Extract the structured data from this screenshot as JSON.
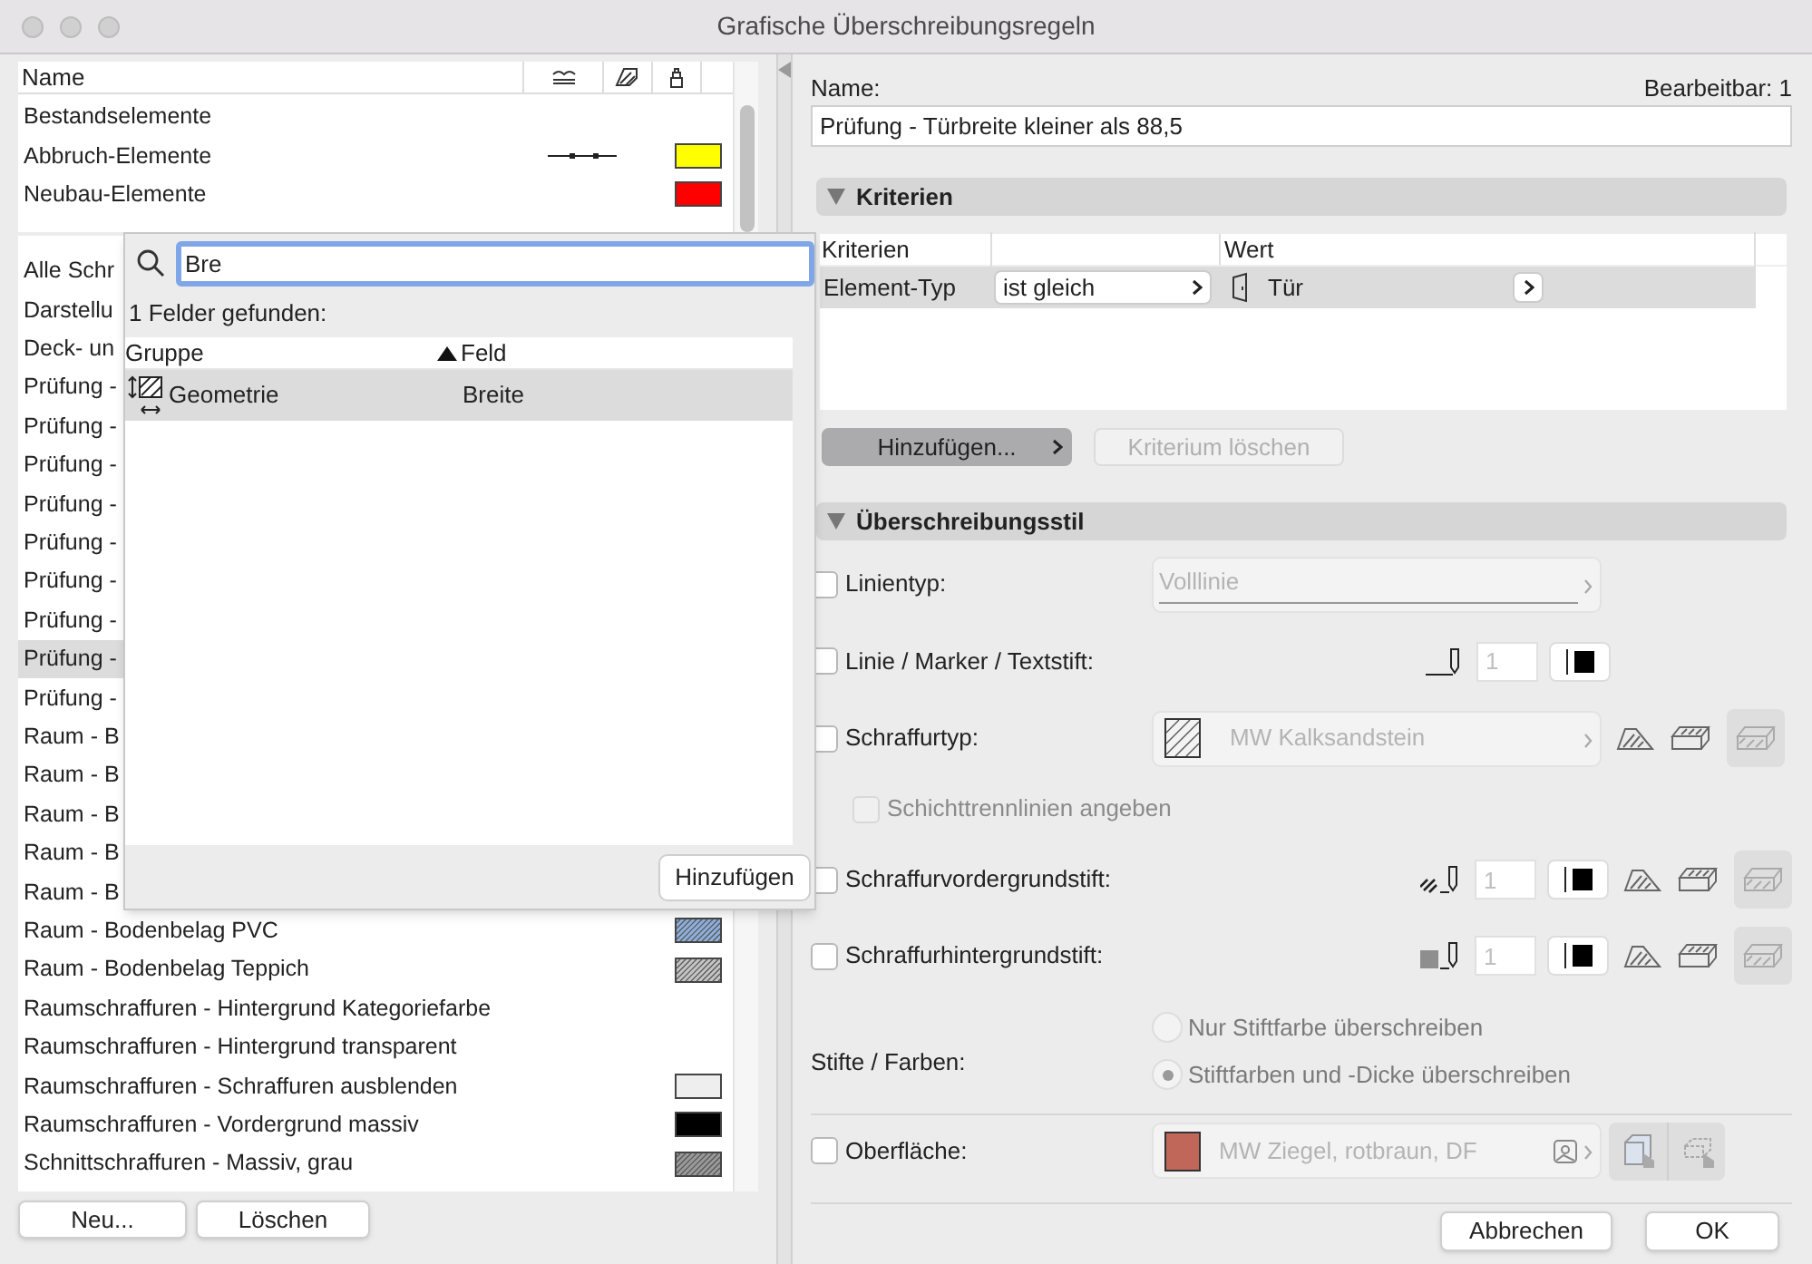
{
  "window": {
    "title": "Grafische Überschreibungsregeln"
  },
  "rule_list": {
    "column": "Name",
    "top_rows": [
      {
        "name": "Bestandselemente",
        "selected": false,
        "line_style": false
      },
      {
        "name": "Abbruch-Elemente",
        "selected": false,
        "line_style": true,
        "swatch": {
          "color": "#ffff00",
          "hatched": false
        }
      },
      {
        "name": "Neubau-Elemente",
        "selected": false,
        "line_style": false,
        "swatch": {
          "color": "#ff0000",
          "hatched": false
        }
      }
    ],
    "rows": [
      {
        "name": "Alle Schr",
        "selected": false
      },
      {
        "name": "Darstellu",
        "selected": false
      },
      {
        "name": "Deck- un",
        "selected": false
      },
      {
        "name": "Prüfung -",
        "selected": false
      },
      {
        "name": "Prüfung -",
        "selected": false
      },
      {
        "name": "Prüfung -",
        "selected": false
      },
      {
        "name": "Prüfung -",
        "selected": false
      },
      {
        "name": "Prüfung -",
        "selected": false
      },
      {
        "name": "Prüfung -",
        "selected": false
      },
      {
        "name": "Prüfung -",
        "selected": false
      },
      {
        "name": "Prüfung -",
        "selected": true
      },
      {
        "name": "Prüfung -",
        "selected": false
      },
      {
        "name": "Raum - B",
        "selected": false
      },
      {
        "name": "Raum - B",
        "selected": false
      },
      {
        "name": "Raum - B",
        "selected": false
      },
      {
        "name": "Raum - B",
        "selected": false
      },
      {
        "name": "Raum - B",
        "selected": false
      },
      {
        "name": "Raum - Bodenbelag PVC",
        "selected": false,
        "swatch": {
          "color": "#8fb0dc",
          "hatched": true
        }
      },
      {
        "name": "Raum - Bodenbelag Teppich",
        "selected": false,
        "swatch": {
          "color": "#c4c4c4",
          "hatched": true
        }
      },
      {
        "name": "Raumschraffuren - Hintergrund Kategoriefarbe",
        "selected": false
      },
      {
        "name": "Raumschraffuren - Hintergrund transparent",
        "selected": false
      },
      {
        "name": "Raumschraffuren - Schraffuren ausblenden",
        "selected": false,
        "swatch": {
          "color": "#eeeeee",
          "hatched": false
        }
      },
      {
        "name": "Raumschraffuren - Vordergrund massiv",
        "selected": false,
        "swatch": {
          "color": "#000000",
          "hatched": false
        }
      },
      {
        "name": "Schnittschraffuren - Massiv, grau",
        "selected": false,
        "swatch": {
          "color": "#9a9a9a",
          "hatched": true
        }
      }
    ],
    "buttons": [
      "Neu...",
      "Löschen"
    ]
  },
  "search_popup": {
    "query": "Bre",
    "result_count": "1 Felder gefunden:",
    "columns": [
      {
        "label": "Gruppe",
        "sorted": false
      },
      {
        "label": "Feld",
        "sorted": true
      }
    ],
    "results": [
      {
        "group": "Geometrie",
        "field": "Breite",
        "selected": true
      }
    ],
    "add_button": "Hinzufügen"
  },
  "editor": {
    "name_label": "Name:",
    "editable": "Bearbeitbar: 1",
    "name_value": "Prüfung - Türbreite kleiner als 88,5",
    "criteria_section": {
      "title": "Kriterien",
      "expanded": true,
      "columns": {
        "criterion": "Kriterien",
        "value": "Wert"
      },
      "rows": [
        {
          "criterion": "Element-Typ",
          "operator": "ist gleich",
          "value": "Tür",
          "selected": true
        }
      ],
      "buttons": [
        {
          "label": "Hinzufügen...",
          "disabled": false
        },
        {
          "label": "Kriterium löschen",
          "disabled": true
        }
      ]
    },
    "style_section": {
      "title": "Überschreibungsstil",
      "expanded": true,
      "options": [
        {
          "kind": "linetype",
          "label": "Linientyp:",
          "checked": false,
          "value": "Volllinie"
        },
        {
          "kind": "pen",
          "label": "Linie / Marker / Textstift:",
          "checked": false,
          "pen": "1"
        },
        {
          "kind": "hatch",
          "label": "Schraffurtyp:",
          "checked": false,
          "value": "MW Kalksandstein"
        },
        {
          "kind": "subcheck",
          "label": "Schichttrennlinien angeben",
          "checked": false,
          "disabled": true
        },
        {
          "kind": "hatchpen",
          "label": "Schraffurvordergrundstift:",
          "checked": false,
          "pen": "1"
        },
        {
          "kind": "hatchpen",
          "label": "Schraffurhintergrundstift:",
          "checked": false,
          "pen": "1"
        },
        {
          "kind": "radio",
          "label": "Stifte / Farben:",
          "choices": [
            {
              "label": "Nur Stiftfarbe überschreiben",
              "selected": false
            },
            {
              "label": "Stiftfarben und -Dicke überschreiben",
              "selected": true
            }
          ]
        },
        {
          "kind": "surface",
          "label": "Oberfläche:",
          "checked": false,
          "value": "MW Ziegel, rotbraun, DF"
        }
      ]
    }
  },
  "footer_buttons": [
    "Abbrechen",
    "OK"
  ]
}
